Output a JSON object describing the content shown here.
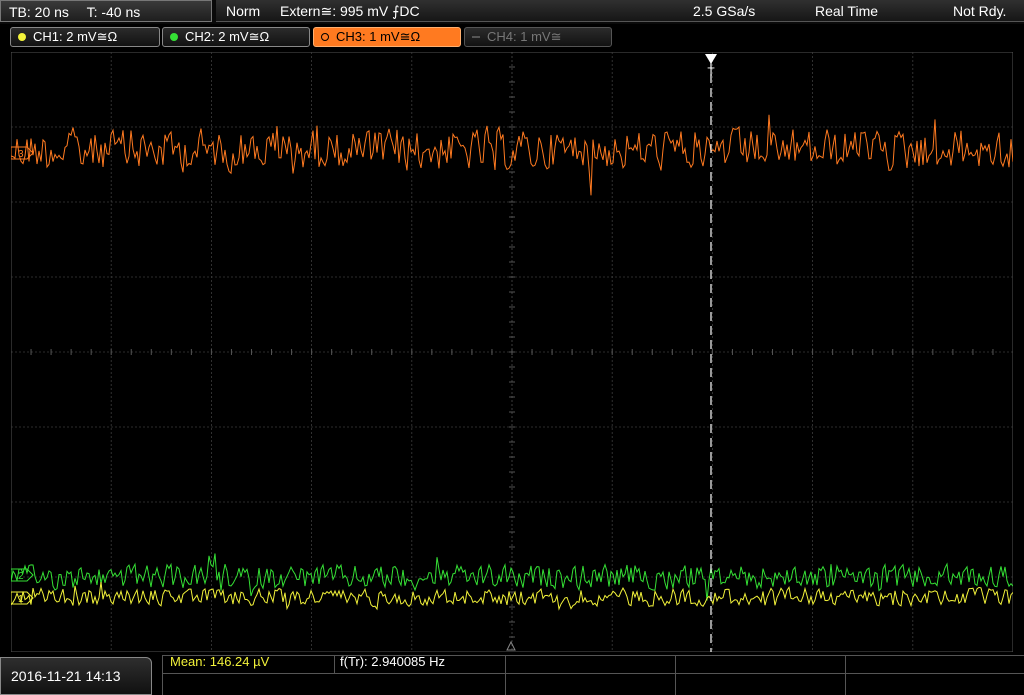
{
  "topbar": {
    "timebase": "TB: 20 ns",
    "trigger_time": "T: -40 ns",
    "mode": "Norm",
    "trigger_source": "Extern≅: 995 mV ⨍DC",
    "sample_rate": "2.5 GSa/s",
    "acq_mode": "Real Time",
    "state": "Not Rdy."
  },
  "channels": [
    {
      "label": "CH1: 2 mV≅Ω",
      "color": "#f2f23a",
      "active": true,
      "selected": false
    },
    {
      "label": "CH2: 2 mV≅Ω",
      "color": "#35e035",
      "active": true,
      "selected": false
    },
    {
      "label": "CH3: 1 mV≅Ω",
      "color": "#ff7a20",
      "active": true,
      "selected": true
    },
    {
      "label": "CH4: 1 mV≅",
      "color": "#777777",
      "active": false,
      "selected": false
    }
  ],
  "markers": {
    "trigger": "T",
    "ch3": "3",
    "ch2": "2",
    "ch1": "1"
  },
  "footer": {
    "datetime": "2016-11-21 14:13",
    "mean": "Mean: 146.24 µV",
    "freq": "f(Tr): 2.940085 Hz"
  },
  "colors": {
    "grid": "#3c3c3c",
    "ch1": "#f2f23a",
    "ch2": "#35e035",
    "ch3": "#ff7a20",
    "trigger": "#ffffff"
  }
}
